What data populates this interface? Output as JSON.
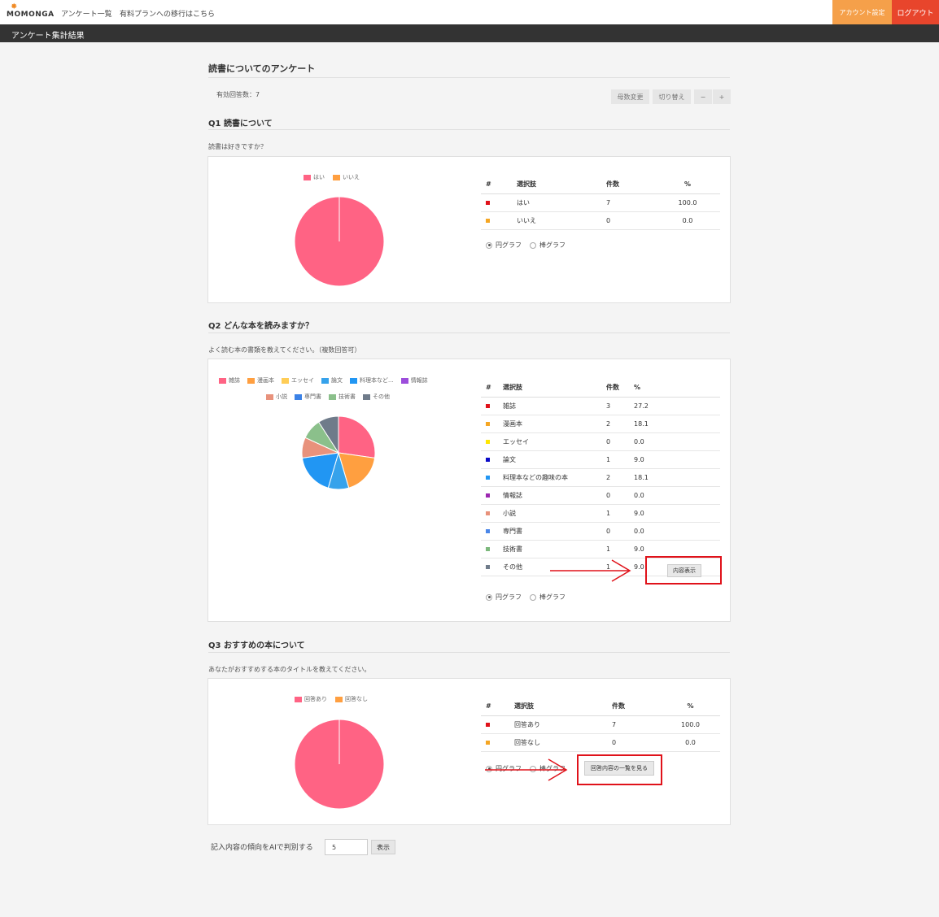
{
  "nav": {
    "logo": "MOMONGA",
    "links": [
      "アンケート一覧",
      "有料プランへの移行はこちら"
    ],
    "account_button": "アカウント設定",
    "logout_button": "ログアウト"
  },
  "subheader": {
    "title": "アンケート集計結果"
  },
  "survey": {
    "title": "読書についてのアンケート",
    "valid_responses_label": "有効回答数：7",
    "tool_buttons": [
      "母数変更",
      "切り替え",
      "−",
      "+"
    ]
  },
  "questions": [
    {
      "title": "Q1 読書について",
      "description": "読書は好きですか？",
      "table_headers": [
        "#",
        "選択肢",
        "件数",
        "%"
      ],
      "rows": [
        {
          "color": "#e0121a",
          "label": "はい",
          "count": "7",
          "pct": "100.0"
        },
        {
          "color": "#f5a623",
          "label": "いいえ",
          "count": "0",
          "pct": "0.0"
        }
      ],
      "chart_toggle": {
        "pie": "円グラフ",
        "bar": "棒グラフ",
        "selected": "pie"
      }
    },
    {
      "title": "Q2 どんな本を読みますか？",
      "description": "よく読む本の書類を教えてください。（複数回答可）",
      "table_headers": [
        "#",
        "選択肢",
        "件数",
        "%"
      ],
      "rows": [
        {
          "color": "#e0121a",
          "label": "雑誌",
          "count": "3",
          "pct": "27.2"
        },
        {
          "color": "#f5a623",
          "label": "漫画本",
          "count": "2",
          "pct": "18.1"
        },
        {
          "color": "#ffe600",
          "label": "エッセイ",
          "count": "0",
          "pct": "0.0"
        },
        {
          "color": "#0a0ac8",
          "label": "論文",
          "count": "1",
          "pct": "9.0"
        },
        {
          "color": "#2196f3",
          "label": "料理本などの趣味の本",
          "count": "2",
          "pct": "18.1"
        },
        {
          "color": "#9c27b0",
          "label": "情報誌",
          "count": "0",
          "pct": "0.0"
        },
        {
          "color": "#e8917a",
          "label": "小説",
          "count": "1",
          "pct": "9.0"
        },
        {
          "color": "#4a86e8",
          "label": "専門書",
          "count": "0",
          "pct": "0.0"
        },
        {
          "color": "#7cb87c",
          "label": "技術書",
          "count": "1",
          "pct": "9.0"
        },
        {
          "color": "#6f7b8a",
          "label": "その他",
          "count": "1",
          "pct": "9.0"
        }
      ],
      "show_content_button": "内容表示",
      "chart_toggle": {
        "pie": "円グラフ",
        "bar": "棒グラフ",
        "selected": "pie"
      }
    },
    {
      "title": "Q3 おすすめの本について",
      "description": "あなたがおすすめする本のタイトルを教えてください。",
      "table_headers": [
        "#",
        "選択肢",
        "件数",
        "%"
      ],
      "rows": [
        {
          "color": "#e0121a",
          "label": "回答あり",
          "count": "7",
          "pct": "100.0"
        },
        {
          "color": "#f5a623",
          "label": "回答なし",
          "count": "0",
          "pct": "0.0"
        }
      ],
      "view_answers_button": "回答内容の一覧を見る",
      "chart_toggle": {
        "pie": "円グラフ",
        "bar": "棒グラフ",
        "selected": "pie"
      }
    }
  ],
  "ai": {
    "label": "記入内容の傾向をAIで判別する",
    "input_value": "5",
    "button": "表示"
  },
  "chart_data": [
    {
      "type": "pie",
      "legend": [
        "はい",
        "いいえ"
      ],
      "values": [
        7,
        0
      ],
      "colors": [
        "#ff6384",
        "#ff9f40"
      ]
    },
    {
      "type": "pie",
      "legend": [
        "雑誌",
        "漫画本",
        "エッセイ",
        "論文",
        "料理本など...",
        "情報誌",
        "小説",
        "専門書",
        "技術書",
        "その他"
      ],
      "values": [
        3,
        2,
        0,
        1,
        2,
        0,
        1,
        0,
        1,
        1
      ],
      "colors": [
        "#ff6384",
        "#ff9f40",
        "#ffcd56",
        "#36a2eb",
        "#2196f3",
        "#9c4ddb",
        "#e8927c",
        "#3b82e6",
        "#8bc08b",
        "#6f7b8a"
      ]
    },
    {
      "type": "pie",
      "legend": [
        "回答あり",
        "回答なし"
      ],
      "values": [
        7,
        0
      ],
      "colors": [
        "#ff6384",
        "#ff9f40"
      ]
    }
  ]
}
